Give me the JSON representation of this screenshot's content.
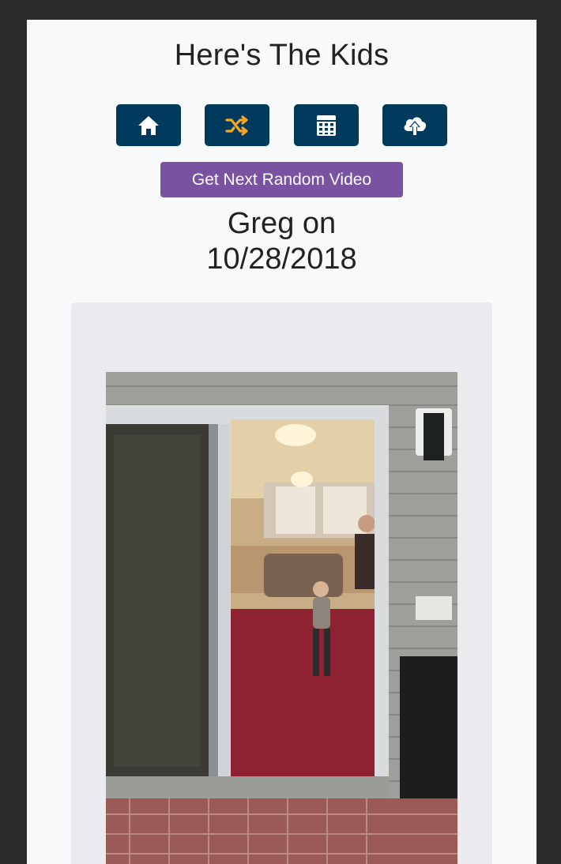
{
  "page": {
    "title": "Here's The Kids"
  },
  "nav": {
    "buttons": [
      {
        "icon": "home-icon"
      },
      {
        "icon": "shuffle-icon"
      },
      {
        "icon": "calendar-icon"
      },
      {
        "icon": "cloud-upload-icon"
      }
    ],
    "icon_color": "#ffffff",
    "shuffle_color": "#f5a623",
    "button_color": "#003a5c"
  },
  "random_button": {
    "label": "Get Next Random Video",
    "color": "#7952a2"
  },
  "video": {
    "heading_line1": "Greg on",
    "heading_line2": "10/28/2018"
  }
}
